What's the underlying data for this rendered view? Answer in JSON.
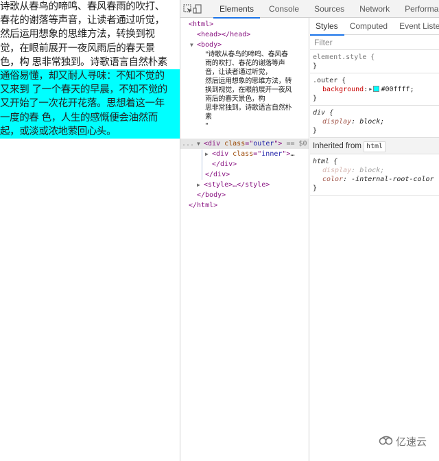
{
  "page": {
    "outer_background": "#00ffff",
    "plain_lines": [
      "诗歌从春鸟的啼鸣、春风春雨的吹打、",
      "春花的谢落等声音，让读者通过听觉，",
      "然后运用想象的思维方法，转换到视",
      "觉，在眼前展开一夜风雨后的春天景",
      "色，构 思非常独到。诗歌语言自然朴素"
    ],
    "outer_lines": [
      "通俗易懂，却又耐人寻味：不知不觉的",
      "又来到 了一个春天的早晨，不知不觉的",
      "又开始了一次花开花落。思想着这一年",
      "一度的春 色，人生的感慨便会油然而",
      "起，或淡或浓地萦回心头。"
    ]
  },
  "devtools": {
    "toolbar": {
      "inspect_icon": "inspect-element-icon",
      "device_icon": "device-toolbar-icon",
      "tabs": [
        "Elements",
        "Console",
        "Sources",
        "Network",
        "Performa"
      ],
      "active_tab": "Elements"
    },
    "elements": {
      "html_open": "<html>",
      "head": "<head></head>",
      "body_open": "<body>",
      "text_lines": [
        "\"诗歌从春鸟的啼鸣、春风春",
        "雨的吹打、春花的谢落等声",
        "音，让读者通过听觉，",
        "然后运用想象的思维方法，转",
        "换到视觉，在眼前展开一夜风",
        "雨后的春天景色，构",
        "思非常独到。诗歌语言自然朴",
        "素",
        "\""
      ],
      "selected_ellipsis": "...",
      "outer_div": {
        "tag": "div",
        "attr": "class",
        "value": "outer",
        "suffix": " == $0"
      },
      "inner_div": {
        "tag": "div",
        "attr": "class",
        "value": "inner",
        "suffix": "…"
      },
      "close_div_1": "</div>",
      "close_div_2": "</div>",
      "style": "<style>…</style>",
      "body_close": "</body>",
      "html_close": "</html>"
    },
    "styles": {
      "tabs": [
        "Styles",
        "Computed",
        "Event Listene"
      ],
      "active_tab": "Styles",
      "filter_placeholder": "Filter",
      "rules": [
        {
          "selector": "element.style {",
          "decls": [],
          "close": "}"
        },
        {
          "selector": ".outer {",
          "decls": [
            {
              "prop": "background",
              "value": "#00ffff;"
            }
          ],
          "close": "}"
        },
        {
          "selector": "div {",
          "decls": [
            {
              "prop": "display",
              "value": "block;"
            }
          ],
          "close": "}"
        }
      ],
      "inherited_label": "Inherited from",
      "inherited_chip": "html",
      "html_rule": {
        "selector": "html {",
        "decls": [
          {
            "prop": "display",
            "value": "block;"
          },
          {
            "prop": "color",
            "value": "-internal-root-color"
          }
        ],
        "close": "}"
      }
    }
  },
  "watermark": {
    "text": "亿速云",
    "icon": "cloud-logo-icon"
  }
}
